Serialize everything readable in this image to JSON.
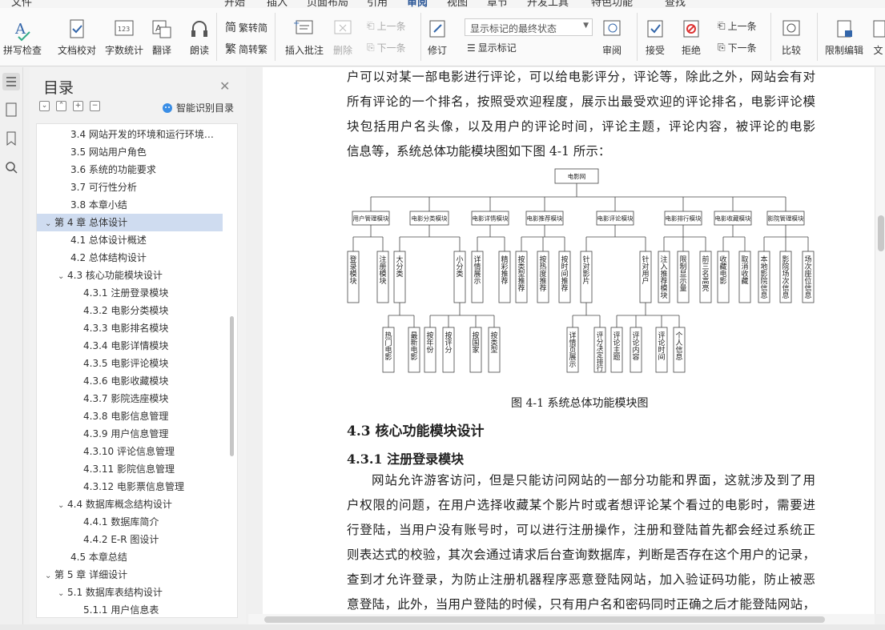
{
  "menubar": {
    "items": [
      "文件",
      "开始",
      "插入",
      "页面布局",
      "引用",
      "审阅",
      "视图",
      "章节",
      "开发工具",
      "特色功能",
      "查找"
    ],
    "active": "审阅"
  },
  "ribbon": {
    "spell_check": "拼写检查",
    "doc_proof": "文档校对",
    "word_count": "字数统计",
    "translate": "翻译",
    "read_aloud": "朗读",
    "to_traditional": "繁转简",
    "to_simplified": "简转繁",
    "insert_comment": "插入批注",
    "delete": "删除",
    "prev_comment": "上一条",
    "next_comment": "下一条",
    "revise": "修订",
    "track_state": "显示标记的最终状态",
    "show_markup": "显示标记",
    "review": "审阅",
    "accept": "接受",
    "reject": "拒绝",
    "prev_change": "上一条",
    "next_change": "下一条",
    "compare": "比较",
    "restrict_edit": "限制编辑",
    "doc_more": "文"
  },
  "toc": {
    "title": "目录",
    "smart_label": "智能识别目录",
    "items": [
      {
        "text": "3.4  网站开发的环境和运行环境…",
        "indent": 2,
        "chev": ""
      },
      {
        "text": "3.5  网站用户角色",
        "indent": 2,
        "chev": ""
      },
      {
        "text": "3.6  系统的功能要求",
        "indent": 2,
        "chev": ""
      },
      {
        "text": "3.7  可行性分析",
        "indent": 2,
        "chev": ""
      },
      {
        "text": "3.8  本章小结",
        "indent": 2,
        "chev": ""
      },
      {
        "text": "第 4 章  总体设计",
        "indent": 1,
        "chev": "v",
        "sel": true
      },
      {
        "text": "4.1  总体设计概述",
        "indent": 2,
        "chev": ""
      },
      {
        "text": "4.2  总体结构设计",
        "indent": 2,
        "chev": ""
      },
      {
        "text": "4.3  核心功能模块设计",
        "indent": 2,
        "chev": "v"
      },
      {
        "text": "4.3.1  注册登录模块",
        "indent": 3,
        "chev": ""
      },
      {
        "text": "4.3.2  电影分类模块",
        "indent": 3,
        "chev": ""
      },
      {
        "text": "4.3.3  电影排名模块",
        "indent": 3,
        "chev": ""
      },
      {
        "text": "4.3.4  电影详情模块",
        "indent": 3,
        "chev": ""
      },
      {
        "text": "4.3.5  电影评论模块",
        "indent": 3,
        "chev": ""
      },
      {
        "text": "4.3.6  电影收藏模块",
        "indent": 3,
        "chev": ""
      },
      {
        "text": "4.3.7  影院选座模块",
        "indent": 3,
        "chev": ""
      },
      {
        "text": "4.3.8  电影信息管理",
        "indent": 3,
        "chev": ""
      },
      {
        "text": "4.3.9  用户信息管理",
        "indent": 3,
        "chev": ""
      },
      {
        "text": "4.3.10  评论信息管理",
        "indent": 3,
        "chev": ""
      },
      {
        "text": "4.3.11  影院信息管理",
        "indent": 3,
        "chev": ""
      },
      {
        "text": "4.3.12  电影票信息管理",
        "indent": 3,
        "chev": ""
      },
      {
        "text": "4.4  数据库概念结构设计",
        "indent": 2,
        "chev": "v"
      },
      {
        "text": "4.4.1  数据库简介",
        "indent": 3,
        "chev": ""
      },
      {
        "text": "4.4.2  E-R 图设计",
        "indent": 3,
        "chev": ""
      },
      {
        "text": "4.5  本章总结",
        "indent": 2,
        "chev": ""
      },
      {
        "text": "第 5 章  详细设计",
        "indent": 1,
        "chev": "v"
      },
      {
        "text": "5.1  数据库表结构设计",
        "indent": 2,
        "chev": "v"
      },
      {
        "text": "5.1.1  用户信息表",
        "indent": 3,
        "chev": ""
      }
    ]
  },
  "doc": {
    "para1": [
      "户可以对某一部电影进行评论，可以给电影评分，评论等，除此之外，网站会有对",
      "所有评论的一个排名，按照受欢迎程度，展示出最受欢迎的评论排名，电影评论模",
      "块包括用户名头像，以及用户的评论时间，评论主题，评论内容，被评论的电影",
      "信息等，系统总体功能模块图如下图 4-1 所示："
    ],
    "caption": "图 4-1  系统总体功能模块图",
    "h43": "4.3    核心功能模块设计",
    "h431": "4.3.1    注册登录模块",
    "para2": [
      "网站允许游客访问，但是只能访问网站的一部分功能和界面，这就涉及到了用",
      "户权限的问题，在用户选择收藏某个影片时或者想评论某个看过的电影时，需要进",
      "行登陆，当用户没有账号时，可以进行注册操作，注册和登陆首先都会经过系统正",
      "则表达式的校验，其次会通过请求后台查询数据库，判断是否存在这个用户的记录，",
      "查到才允许登录，为防止注册机器程序恶意登陆网站，加入验证码功能，防止被恶",
      "意登陆，此外，当用户登陆的时候，只有用户名和密码同时正确之后才能登陆网站，"
    ]
  },
  "diagram": {
    "root": "电影网",
    "level1": [
      "用户管理模块",
      "电影分类模块",
      "电影详情模块",
      "电影推荐模块",
      "电影评论模块",
      "电影排行模块",
      "电影收藏模块",
      "影院管理模块"
    ],
    "level2": [
      "登录模块",
      "注册模块",
      "大分类",
      "小分类",
      "详情展示",
      "精彩推荐",
      "按类型推荐",
      "按热度推荐",
      "按时间推荐",
      "针对影片",
      "针对用户",
      "注入推荐模块",
      "限制显示量",
      "前三名高亮",
      "收藏电影",
      "取消收藏",
      "本地影院信息",
      "影院场次信息",
      "场次座位信息"
    ],
    "level3": [
      "热门电影",
      "最新电影",
      "按年份",
      "按评分",
      "按国家",
      "按类型",
      "详情页展示",
      "评分决定排行",
      "评论主题",
      "评论内容",
      "评论时间",
      "个人信息"
    ]
  }
}
